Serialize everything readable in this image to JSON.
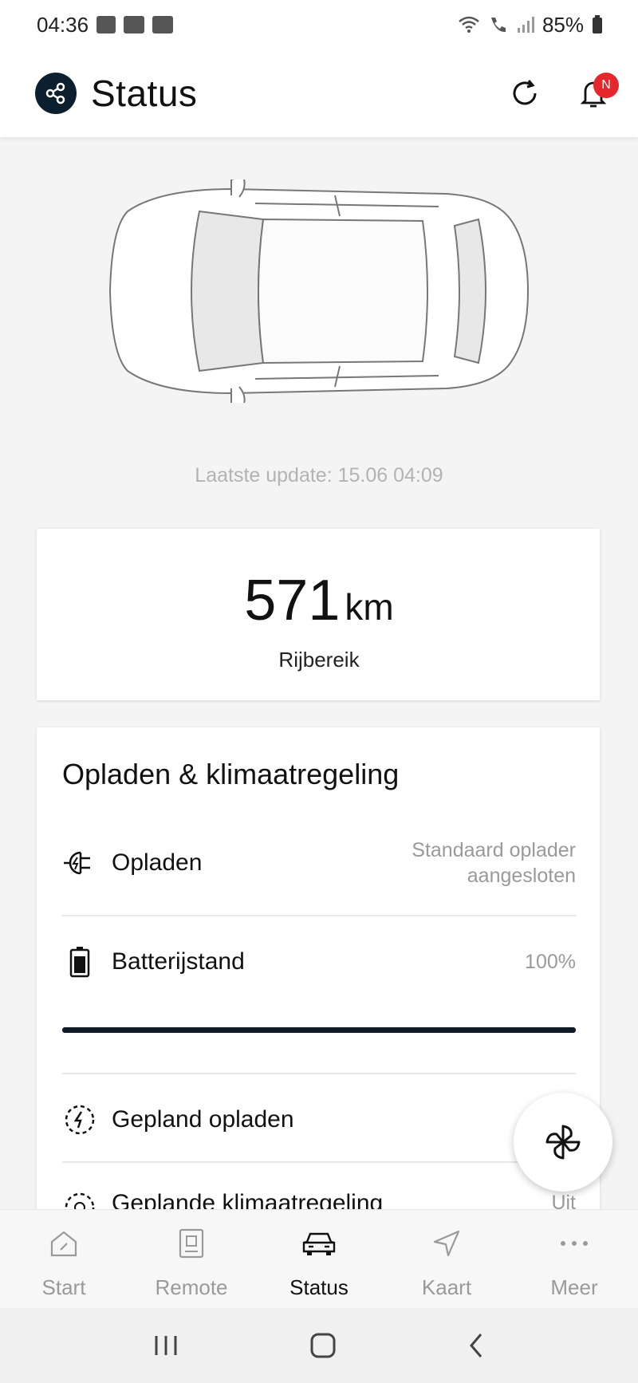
{
  "status_bar": {
    "time": "04:36",
    "battery": "85%"
  },
  "header": {
    "title": "Status",
    "notification_badge": "N"
  },
  "vehicle": {
    "last_update": "Laatste update: 15.06 04:09"
  },
  "range": {
    "value": "571",
    "unit": "km",
    "label": "Rijbereik"
  },
  "charging_section": {
    "title": "Opladen & klimaatregeling",
    "rows": [
      {
        "label": "Opladen",
        "value_line1": "Standaard oplader",
        "value_line2": "aangesloten",
        "icon": "charger-plug-icon"
      },
      {
        "label": "Batterijstand",
        "value": "100%",
        "icon": "battery-icon"
      },
      {
        "label": "Gepland opladen",
        "icon": "scheduled-charge-icon"
      },
      {
        "label": "Geplande klimaatregeling",
        "value": "Uit",
        "icon": "scheduled-climate-icon"
      }
    ],
    "battery_level": 1.0
  },
  "bottom_nav": {
    "items": [
      {
        "label": "Start",
        "icon": "home-icon"
      },
      {
        "label": "Remote",
        "icon": "remote-icon"
      },
      {
        "label": "Status",
        "icon": "car-icon",
        "active": true
      },
      {
        "label": "Kaart",
        "icon": "navigation-icon"
      },
      {
        "label": "Meer",
        "icon": "more-icon"
      }
    ]
  },
  "colors": {
    "accent_dark": "#0b1f2e",
    "badge_red": "#e5262c",
    "muted_text": "#9a9a9a"
  }
}
